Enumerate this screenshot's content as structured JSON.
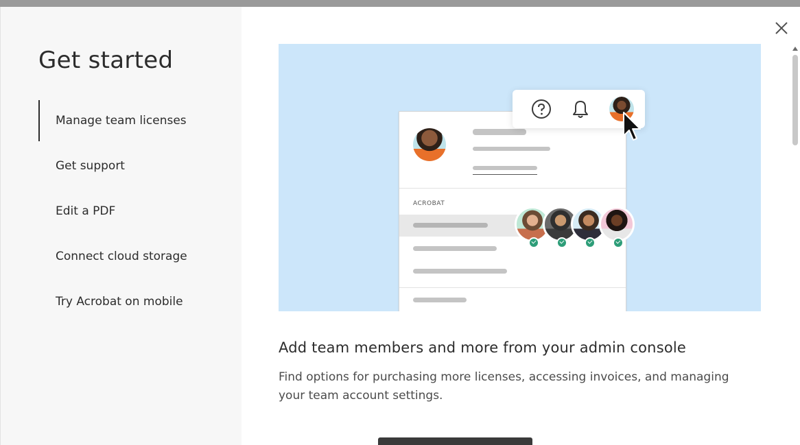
{
  "sidebar": {
    "title": "Get started",
    "items": [
      {
        "label": "Manage team licenses",
        "active": true
      },
      {
        "label": "Get support",
        "active": false
      },
      {
        "label": "Edit a PDF",
        "active": false
      },
      {
        "label": "Connect cloud storage",
        "active": false
      },
      {
        "label": "Try Acrobat on mobile",
        "active": false
      }
    ]
  },
  "hero": {
    "app_label": "ACROBAT",
    "toolbar_icons": [
      "help-icon",
      "bell-icon",
      "user-avatar-icon"
    ],
    "team_member_count": 4,
    "background": "#cce6fa",
    "check_color": "#2d9d78"
  },
  "content": {
    "heading": "Add team members and more from your admin console",
    "description": "Find options for purchasing more licenses, accessing invoices, and managing your team account settings."
  },
  "icons": {
    "close": "close-icon"
  }
}
